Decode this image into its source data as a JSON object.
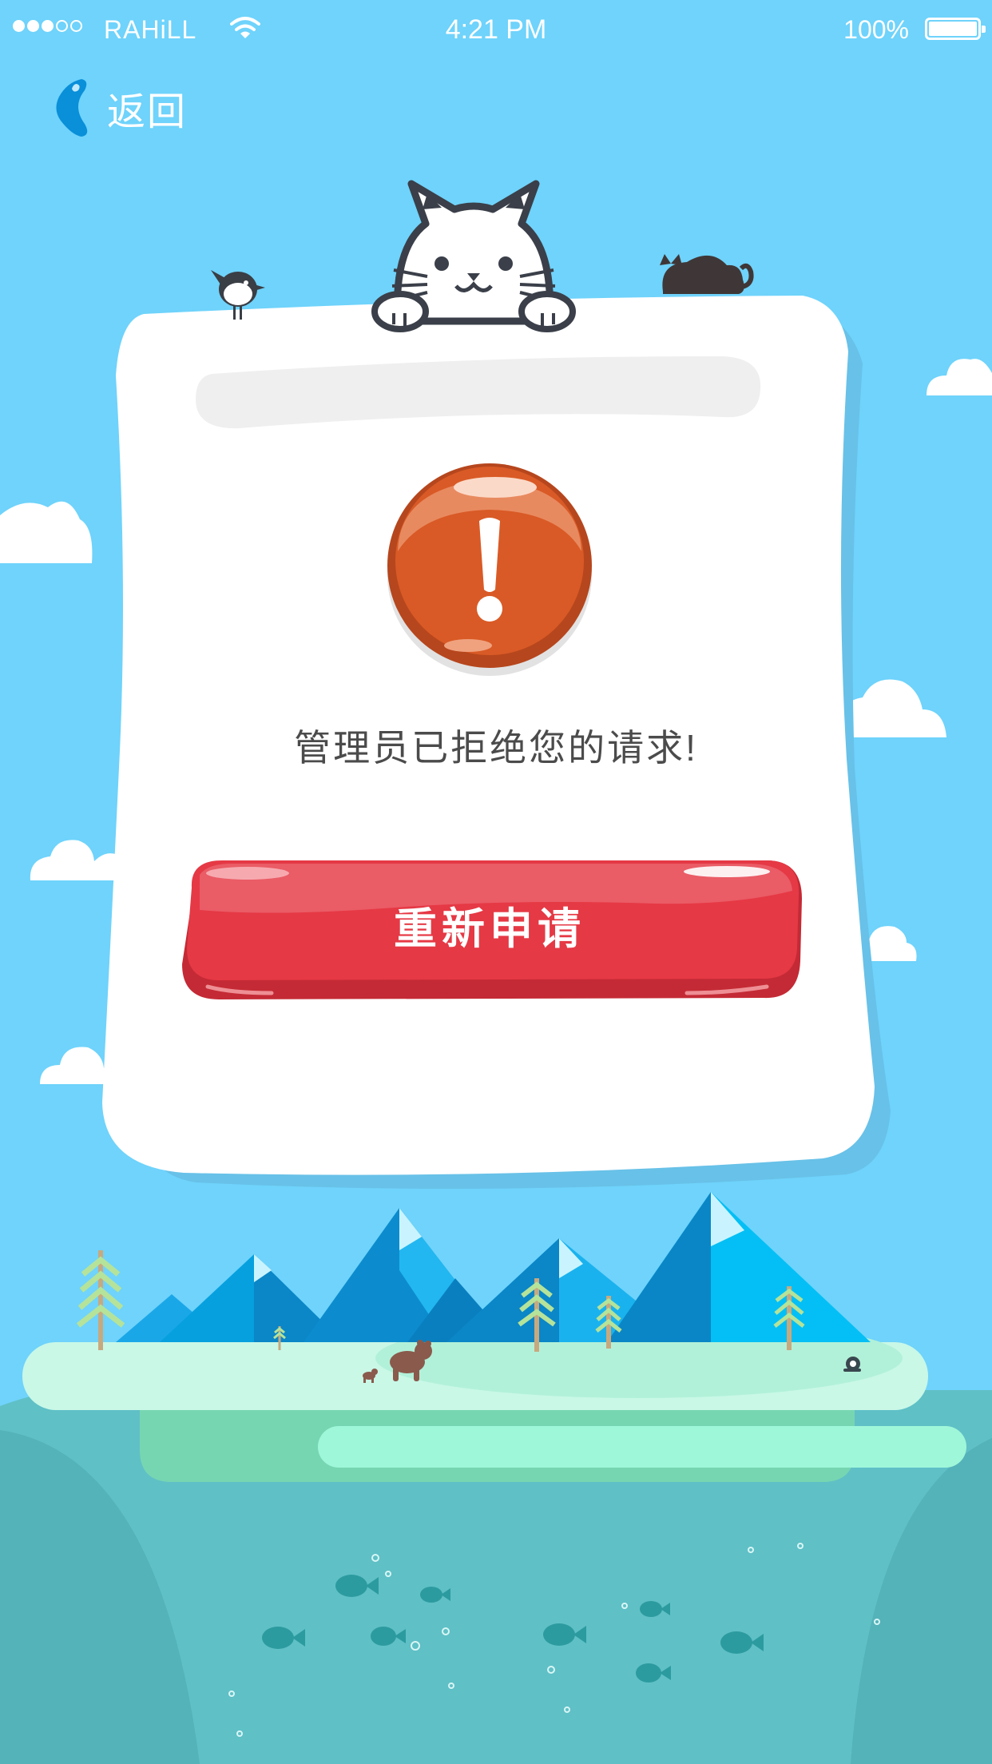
{
  "status_bar": {
    "carrier": "RAHiLL",
    "time": "4:21 PM",
    "battery": "100%",
    "signal_bars": 3,
    "signal_total": 5
  },
  "nav": {
    "back_label": "返回"
  },
  "dialog": {
    "message": "管理员已拒绝您的请求!",
    "button_label": "重新申请"
  },
  "colors": {
    "sky": "#6fd3fb",
    "button": "#e53945",
    "alert": "#d95a26",
    "sea": "#5cbfc5"
  }
}
